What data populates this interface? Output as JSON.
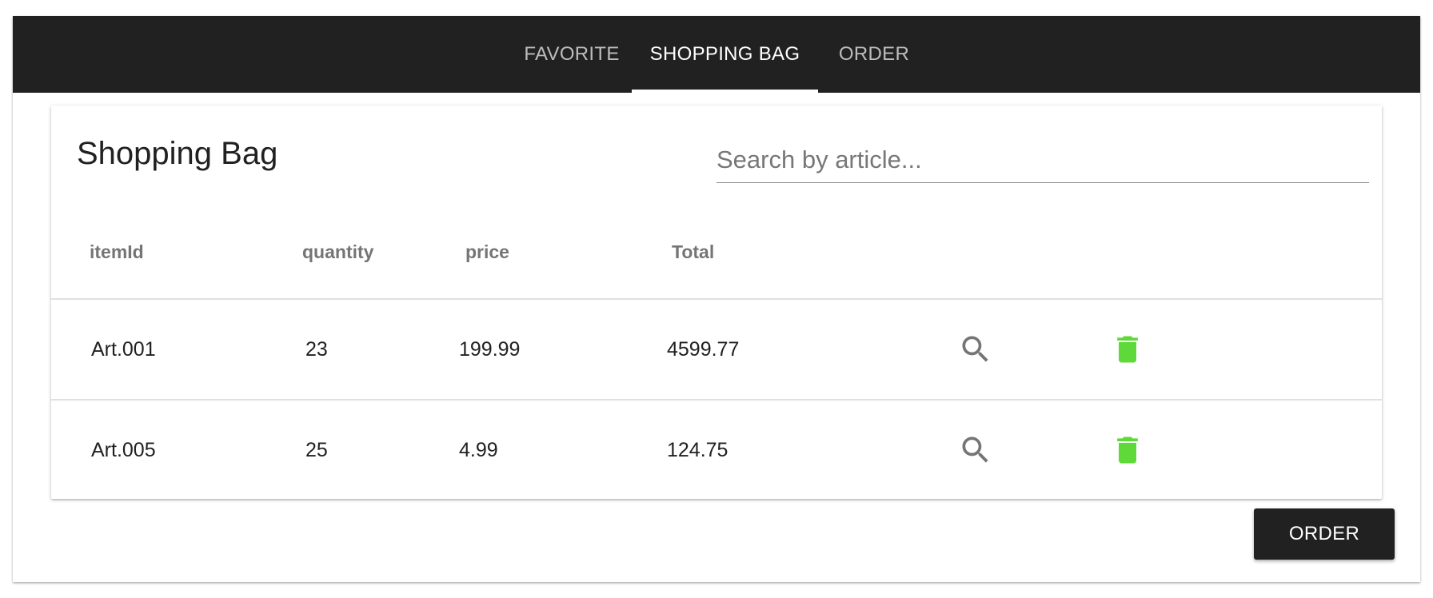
{
  "tabs": [
    {
      "label": "FAVORITE",
      "active": false
    },
    {
      "label": "SHOPPING BAG",
      "active": true
    },
    {
      "label": "ORDER",
      "active": false
    }
  ],
  "card": {
    "title": "Shopping Bag",
    "search_placeholder": "Search by article..."
  },
  "table": {
    "headers": [
      "itemId",
      "quantity",
      "price",
      "Total"
    ],
    "rows": [
      {
        "itemId": "Art.001",
        "quantity": "23",
        "price": "199.99",
        "total": "4599.77",
        "view_icon": "search-icon",
        "delete_icon": "trash-icon"
      },
      {
        "itemId": "Art.005",
        "quantity": "25",
        "price": "4.99",
        "total": "124.75",
        "view_icon": "search-icon",
        "delete_icon": "trash-icon"
      }
    ]
  },
  "actions": {
    "order_label": "ORDER"
  },
  "colors": {
    "tabbar_bg": "#212121",
    "delete_icon": "#5fd93a",
    "view_icon": "#757575",
    "order_button_bg": "#212121"
  }
}
